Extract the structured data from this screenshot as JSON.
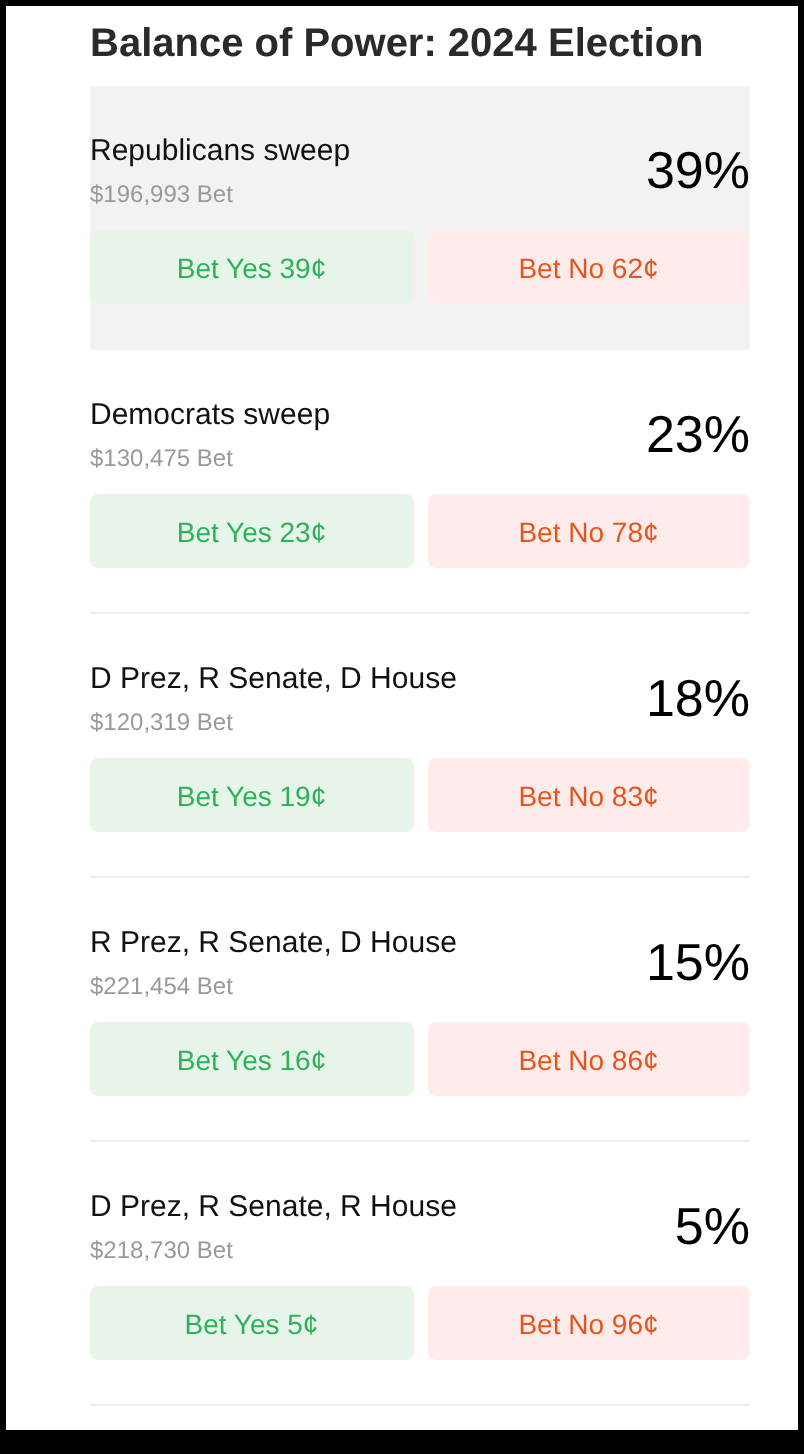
{
  "title": "Balance of Power: 2024 Election",
  "markets": [
    {
      "name": "Republicans sweep",
      "volume": "$196,993 Bet",
      "chance": "39%",
      "yes": "Bet Yes 39¢",
      "no": "Bet No 62¢",
      "selected": true
    },
    {
      "name": "Democrats sweep",
      "volume": "$130,475 Bet",
      "chance": "23%",
      "yes": "Bet Yes 23¢",
      "no": "Bet No 78¢",
      "selected": false
    },
    {
      "name": "D Prez, R Senate, D House",
      "volume": "$120,319 Bet",
      "chance": "18%",
      "yes": "Bet Yes 19¢",
      "no": "Bet No 83¢",
      "selected": false
    },
    {
      "name": "R Prez, R Senate, D House",
      "volume": "$221,454 Bet",
      "chance": "15%",
      "yes": "Bet Yes 16¢",
      "no": "Bet No 86¢",
      "selected": false
    },
    {
      "name": "D Prez, R Senate, R House",
      "volume": "$218,730 Bet",
      "chance": "5%",
      "yes": "Bet Yes 5¢",
      "no": "Bet No 96¢",
      "selected": false
    }
  ]
}
